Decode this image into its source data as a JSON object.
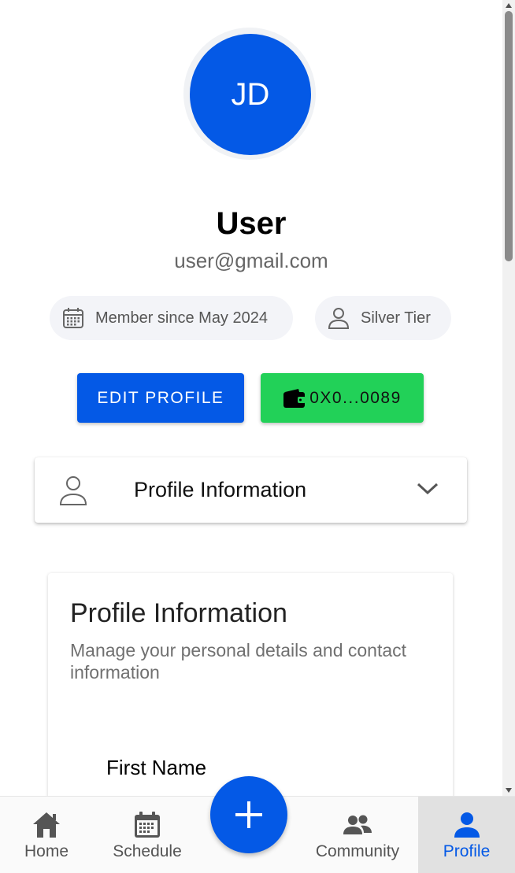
{
  "profile": {
    "initials": "JD",
    "name": "User",
    "email": "user@gmail.com"
  },
  "chips": {
    "member_since": "Member since May 2024",
    "tier": "Silver Tier"
  },
  "actions": {
    "edit_profile_label": "EDIT PROFILE",
    "wallet_label": "0X0...0089"
  },
  "accordion": {
    "label": "Profile Information"
  },
  "card": {
    "title": "Profile Information",
    "description": "Manage your personal details and contact information",
    "first_name_label": "First Name"
  },
  "bottom_nav": {
    "items": [
      {
        "label": "Home",
        "icon": "home-icon"
      },
      {
        "label": "Schedule",
        "icon": "calendar-icon"
      },
      {
        "label": "Community",
        "icon": "group-icon"
      },
      {
        "label": "Profile",
        "icon": "person-icon",
        "active": true
      }
    ],
    "fab_icon": "plus-icon"
  },
  "colors": {
    "primary": "#0459e6",
    "wallet_green": "#22d158",
    "chip_bg": "#f3f4f8",
    "active_nav_bg": "#e1e1e1"
  }
}
